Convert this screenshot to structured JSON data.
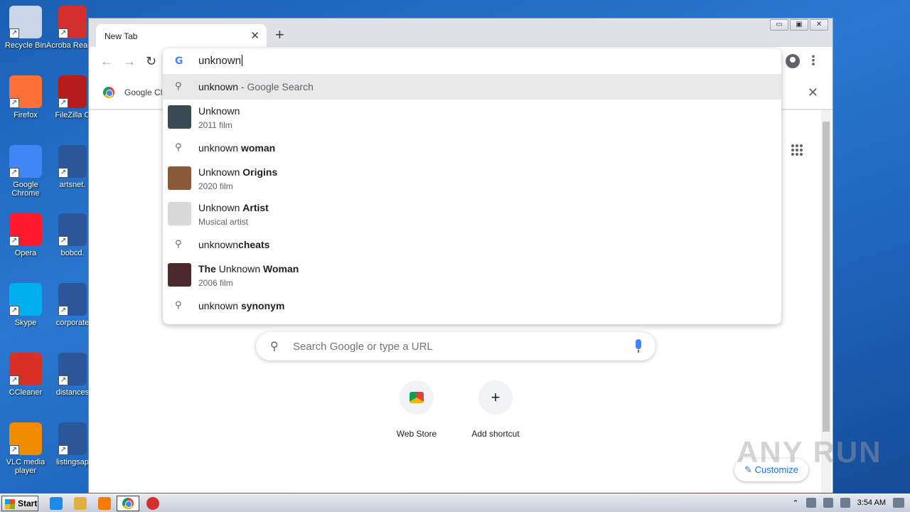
{
  "desktop": {
    "icons_col1": [
      {
        "label": "Recycle Bin",
        "color": "#c8d6e8"
      },
      {
        "label": "Firefox",
        "color": "#ff7139"
      },
      {
        "label": "Google Chrome",
        "color": "#4285f4"
      },
      {
        "label": "Opera",
        "color": "#ff1b2d"
      },
      {
        "label": "Skype",
        "color": "#00aff0"
      },
      {
        "label": "CCleaner",
        "color": "#d93025"
      },
      {
        "label": "VLC media player",
        "color": "#f08c00"
      }
    ],
    "icons_col2": [
      {
        "label": "Acroba Reader",
        "color": "#d32f2f"
      },
      {
        "label": "FileZilla C",
        "color": "#b71c1c"
      },
      {
        "label": "artsnet.",
        "color": "#2b579a"
      },
      {
        "label": "bobcd.",
        "color": "#2b579a"
      },
      {
        "label": "corporate",
        "color": "#2b579a"
      },
      {
        "label": "distances",
        "color": "#2b579a"
      },
      {
        "label": "listingsap",
        "color": "#2b579a"
      }
    ]
  },
  "browser": {
    "tab_title": "New Tab",
    "tab_close": "✕",
    "new_tab": "+",
    "back": "←",
    "forward": "→",
    "reload": "↻",
    "menu": "⋮",
    "bookmark_label": "Google Cl",
    "bookmark_close": "✕",
    "window_buttons": [
      "▭",
      "▣",
      "✕"
    ]
  },
  "omnibox": {
    "logo": "G",
    "text": "unknown",
    "suggestions": [
      {
        "type": "search",
        "prefix": "unknown",
        "bold": "",
        "suffix": " - Google Search",
        "selected": true
      },
      {
        "type": "entity",
        "prefix": "Unknown",
        "bold": "",
        "subtitle": "2011 film",
        "thumb": "#3a4a52"
      },
      {
        "type": "search",
        "prefix": "unknown ",
        "bold": "woman",
        "suffix": ""
      },
      {
        "type": "entity",
        "prefix": "Unknown ",
        "bold": "Origins",
        "subtitle": "2020 film",
        "thumb": "#8a5a3a"
      },
      {
        "type": "entity",
        "prefix": "Unknown ",
        "bold": "Artist",
        "subtitle": "Musical artist",
        "thumb": "#d8d8d8"
      },
      {
        "type": "search",
        "prefix": "unknown",
        "bold": "cheats",
        "suffix": ""
      },
      {
        "type": "entity",
        "prefix": "",
        "bold": "The ",
        "mid": "Unknown",
        "bold2": " Woman",
        "subtitle": "2006 film",
        "thumb": "#4a2a2a"
      },
      {
        "type": "search",
        "prefix": "unknown ",
        "bold": "synonym",
        "suffix": ""
      }
    ]
  },
  "newtab": {
    "search_placeholder": "Search Google or type a URL",
    "shortcuts": [
      {
        "label": "Web Store"
      },
      {
        "label": "Add shortcut",
        "glyph": "+"
      }
    ],
    "customize": "Customize"
  },
  "taskbar": {
    "start": "Start",
    "time": "3:54 AM"
  },
  "watermark": "ANY RUN"
}
